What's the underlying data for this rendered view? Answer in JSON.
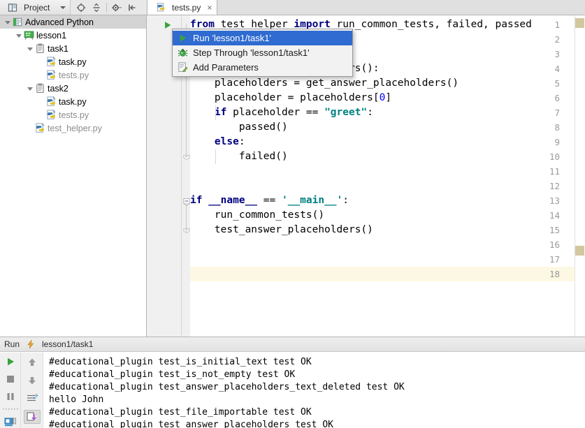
{
  "toolbar": {
    "project_label": "Project",
    "icons": [
      {
        "name": "locate-icon",
        "glyph": "locate"
      },
      {
        "name": "collapse-all-icon",
        "glyph": "collapse"
      },
      {
        "name": "settings-gear-icon",
        "glyph": "gear"
      },
      {
        "name": "hide-panel-icon",
        "glyph": "hide"
      }
    ]
  },
  "editor_tab": {
    "filename": "tests.py",
    "close_label": "×"
  },
  "project_tree": {
    "items": [
      {
        "label": "Advanced Python",
        "icon": "module-icon",
        "depth": 0,
        "expanded": true,
        "dim": false,
        "selected": true
      },
      {
        "label": "lesson1",
        "icon": "lesson-icon",
        "depth": 1,
        "expanded": true,
        "dim": false,
        "selected": false
      },
      {
        "label": "task1",
        "icon": "task-icon",
        "depth": 2,
        "expanded": true,
        "dim": false,
        "selected": false
      },
      {
        "label": "task.py",
        "icon": "python-icon",
        "depth": 3,
        "expanded": false,
        "dim": false,
        "selected": false
      },
      {
        "label": "tests.py",
        "icon": "python-icon",
        "depth": 3,
        "expanded": false,
        "dim": true,
        "selected": false
      },
      {
        "label": "task2",
        "icon": "task-icon",
        "depth": 2,
        "expanded": true,
        "dim": false,
        "selected": false
      },
      {
        "label": "task.py",
        "icon": "python-icon",
        "depth": 3,
        "expanded": false,
        "dim": false,
        "selected": false
      },
      {
        "label": "tests.py",
        "icon": "python-icon",
        "depth": 3,
        "expanded": false,
        "dim": true,
        "selected": false
      },
      {
        "label": "test_helper.py",
        "icon": "python-icon",
        "depth": 2,
        "expanded": false,
        "dim": true,
        "selected": false
      }
    ]
  },
  "context_menu": {
    "items": [
      {
        "label": "Run 'lesson1/task1'",
        "icon": "run-icon",
        "active": true
      },
      {
        "label": "Step Through 'lesson1/task1'",
        "icon": "debug-bug-icon",
        "active": false
      },
      {
        "label": "Add Parameters",
        "icon": "add-parameters-icon",
        "active": false
      }
    ]
  },
  "code": {
    "total_lines": 18,
    "caret_line": 18,
    "run_gutter_line": 1,
    "fold_markers": [
      {
        "line": 10,
        "type": "fold-end"
      },
      {
        "line": 13,
        "type": "fold-collapse"
      },
      {
        "line": 15,
        "type": "fold-end"
      }
    ],
    "lines": [
      {
        "n": 1,
        "tokens": [
          {
            "t": "from ",
            "c": "kw"
          },
          {
            "t": "test_helper ",
            "c": "plain"
          },
          {
            "t": "import ",
            "c": "kw"
          },
          {
            "t": "run_common_tests, failed, passed",
            "c": "plain"
          }
        ]
      },
      {
        "n": 2,
        "tokens": []
      },
      {
        "n": 3,
        "tokens": []
      },
      {
        "n": 4,
        "tokens": [
          {
            "t": "                      ",
            "c": "plain"
          },
          {
            "t": "olders():",
            "c": "plain"
          }
        ]
      },
      {
        "n": 5,
        "tokens": [
          {
            "t": "    placeholders = get_answer_placeholders()",
            "c": "plain"
          }
        ]
      },
      {
        "n": 6,
        "tokens": [
          {
            "t": "    placeholder = placeholders[",
            "c": "plain"
          },
          {
            "t": "0",
            "c": "num"
          },
          {
            "t": "]",
            "c": "plain"
          }
        ]
      },
      {
        "n": 7,
        "tokens": [
          {
            "t": "    ",
            "c": "plain"
          },
          {
            "t": "if ",
            "c": "kw"
          },
          {
            "t": "placeholder == ",
            "c": "plain"
          },
          {
            "t": "\"greet\"",
            "c": "str"
          },
          {
            "t": ":",
            "c": "plain"
          }
        ]
      },
      {
        "n": 8,
        "tokens": [
          {
            "t": "        passed()",
            "c": "plain"
          }
        ]
      },
      {
        "n": 9,
        "tokens": [
          {
            "t": "    ",
            "c": "plain"
          },
          {
            "t": "else",
            "c": "kw"
          },
          {
            "t": ":",
            "c": "plain"
          }
        ]
      },
      {
        "n": 10,
        "tokens": [
          {
            "t": "        failed()",
            "c": "plain"
          }
        ]
      },
      {
        "n": 11,
        "tokens": []
      },
      {
        "n": 12,
        "tokens": []
      },
      {
        "n": 13,
        "tokens": [
          {
            "t": "if ",
            "c": "kw"
          },
          {
            "t": "__name__",
            "c": "dund"
          },
          {
            "t": " == ",
            "c": "plain"
          },
          {
            "t": "'__main__'",
            "c": "str"
          },
          {
            "t": ":",
            "c": "plain"
          }
        ]
      },
      {
        "n": 14,
        "tokens": [
          {
            "t": "    run_common_tests()",
            "c": "plain"
          }
        ]
      },
      {
        "n": 15,
        "tokens": [
          {
            "t": "    test_answer_placeholders()",
            "c": "plain"
          }
        ]
      },
      {
        "n": 16,
        "tokens": []
      },
      {
        "n": 17,
        "tokens": []
      },
      {
        "n": 18,
        "tokens": []
      }
    ]
  },
  "run_panel": {
    "title": "Run",
    "configuration": "lesson1/task1",
    "left_tools": [
      {
        "name": "rerun-button",
        "icon": "play-icon"
      },
      {
        "name": "stop-button",
        "icon": "stop-icon"
      },
      {
        "name": "pause-button",
        "icon": "pause-icon"
      },
      {
        "name": "console-view-button",
        "icon": "console-icon"
      }
    ],
    "right_tools": [
      {
        "name": "up-button",
        "icon": "arrow-up-icon",
        "pressed": false
      },
      {
        "name": "down-button",
        "icon": "arrow-down-icon",
        "pressed": false
      },
      {
        "name": "soft-wrap-button",
        "icon": "soft-wrap-icon",
        "pressed": false
      },
      {
        "name": "scroll-to-end-button",
        "icon": "scroll-end-icon",
        "pressed": true
      }
    ],
    "output": [
      "#educational_plugin test_is_initial_text test OK",
      "#educational_plugin test_is_not_empty test OK",
      "#educational_plugin test_answer_placeholders_text_deleted test OK",
      "hello John",
      "#educational_plugin test_file_importable test OK",
      "#educational_plugin test_answer_placeholders test OK"
    ]
  },
  "colors": {
    "menu_highlight": "#2f6bd0",
    "keyword": "#000080",
    "string": "#008080",
    "number": "#0000ff",
    "caret_line_bg": "#fdf8e3",
    "marker": "#d2c8a0",
    "run_green": "#3aa33a"
  }
}
